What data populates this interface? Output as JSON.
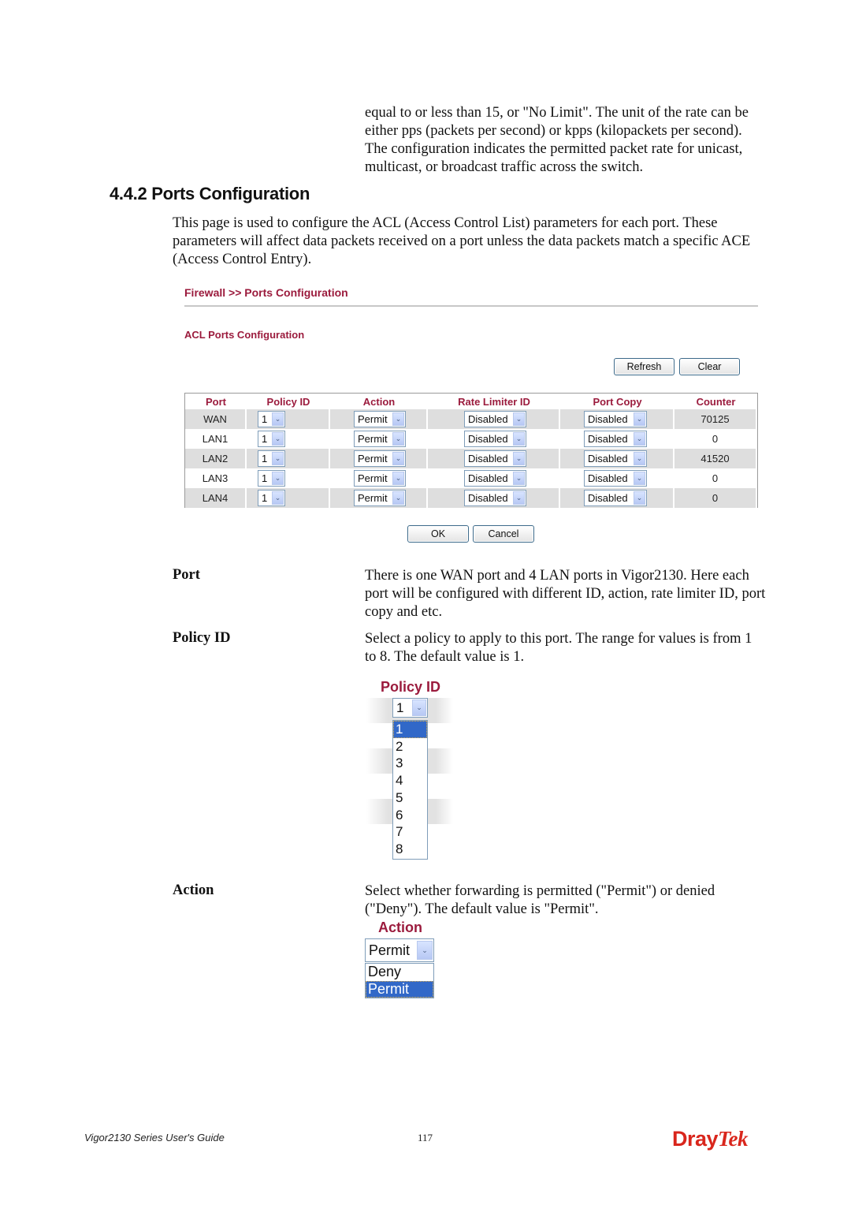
{
  "continuation_paragraph": "equal to or less than 15, or \"No Limit\". The unit of the rate can be either pps (packets per second) or kpps (kilopackets per second). The configuration indicates the permitted packet rate for unicast, multicast, or broadcast traffic across the switch.",
  "section": {
    "heading": "4.4.2 Ports Configuration",
    "intro": "This page is used to configure the ACL (Access Control List) parameters for each port. These parameters will affect data packets received on a port unless the data packets match a specific ACE (Access Control Entry)."
  },
  "ui": {
    "breadcrumb": "Firewall >> Ports Configuration",
    "subtitle": "ACL Ports Configuration",
    "refresh_label": "Refresh",
    "clear_label": "Clear",
    "ok_label": "OK",
    "cancel_label": "Cancel",
    "accent_color": "#9b1b3d",
    "table": {
      "headers": [
        "Port",
        "Policy ID",
        "Action",
        "Rate Limiter ID",
        "Port Copy",
        "Counter"
      ],
      "rows": [
        {
          "port": "WAN",
          "policy_id": "1",
          "action": "Permit",
          "rate_limiter": "Disabled",
          "port_copy": "Disabled",
          "counter": "70125"
        },
        {
          "port": "LAN1",
          "policy_id": "1",
          "action": "Permit",
          "rate_limiter": "Disabled",
          "port_copy": "Disabled",
          "counter": "0"
        },
        {
          "port": "LAN2",
          "policy_id": "1",
          "action": "Permit",
          "rate_limiter": "Disabled",
          "port_copy": "Disabled",
          "counter": "41520"
        },
        {
          "port": "LAN3",
          "policy_id": "1",
          "action": "Permit",
          "rate_limiter": "Disabled",
          "port_copy": "Disabled",
          "counter": "0"
        },
        {
          "port": "LAN4",
          "policy_id": "1",
          "action": "Permit",
          "rate_limiter": "Disabled",
          "port_copy": "Disabled",
          "counter": "0"
        }
      ]
    }
  },
  "definitions": {
    "port": {
      "term": "Port",
      "text": "There is one WAN port and 4 LAN ports in Vigor2130. Here each port will be configured with different ID, action, rate limiter ID, port copy and etc."
    },
    "policy_id": {
      "term": "Policy ID",
      "text": "Select a policy to apply to this port. The range for values is from 1 to 8. The default value is 1.",
      "illustration": {
        "label": "Policy ID",
        "selected": "1",
        "options": [
          "1",
          "2",
          "3",
          "4",
          "5",
          "6",
          "7",
          "8"
        ],
        "highlighted": "1"
      }
    },
    "action": {
      "term": "Action",
      "text": "Select whether forwarding is permitted (\"Permit\") or denied (\"Deny\"). The default value is \"Permit\".",
      "illustration": {
        "label": "Action",
        "selected": "Permit",
        "options": [
          "Deny",
          "Permit"
        ],
        "highlighted": "Permit"
      }
    }
  },
  "footer": {
    "guide_title": "Vigor2130 Series User's Guide",
    "page_number": "117",
    "brand_part1": "Dray",
    "brand_part2": "Tek",
    "brand_color": "#d9261c"
  }
}
